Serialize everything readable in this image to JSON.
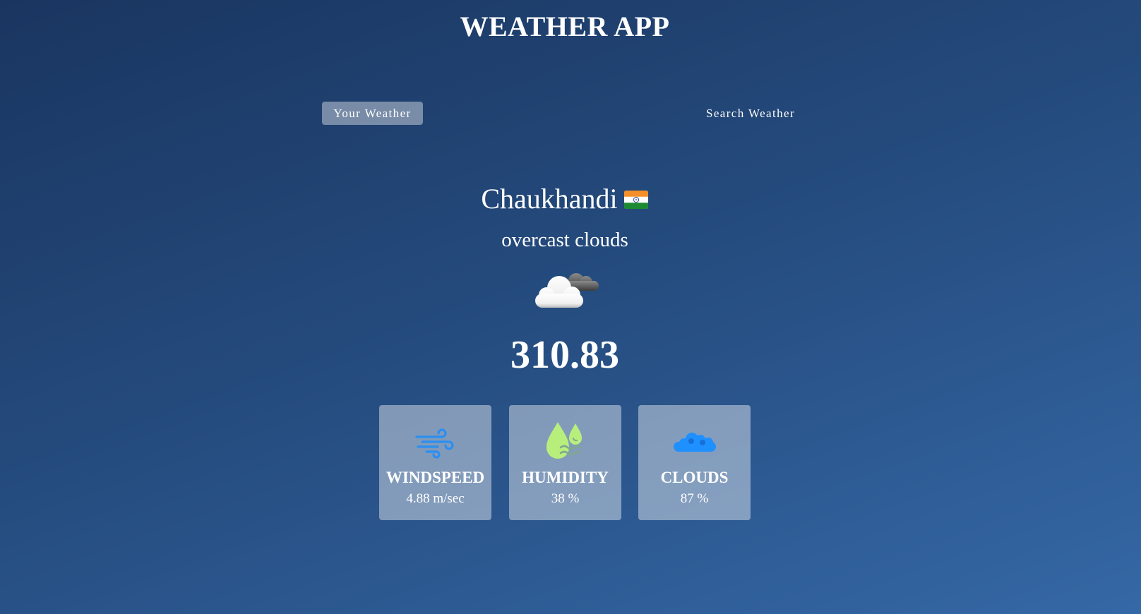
{
  "app": {
    "title": "WEATHER APP"
  },
  "tabs": [
    {
      "label": "Your Weather",
      "active": true
    },
    {
      "label": "Search Weather",
      "active": false
    }
  ],
  "weather": {
    "city": "Chaukhandi",
    "country_flag_icon": "india-flag-icon",
    "description": "overcast clouds",
    "condition_icon": "overcast-clouds-icon",
    "temperature": "310.83"
  },
  "stats": [
    {
      "icon": "wind-icon",
      "label": "WINDSPEED",
      "value": "4.88 m/sec"
    },
    {
      "icon": "humidity-icon",
      "label": "HUMIDITY",
      "value": "38 %"
    },
    {
      "icon": "cloud-icon",
      "label": "CLOUDS",
      "value": "87 %"
    }
  ],
  "colors": {
    "background_top": "#1a3560",
    "background_bottom": "#3568a6",
    "wind_icon": "#2b8ff0",
    "humidity_icon": "#b8ef7c",
    "cloud_icon": "#1e90ff"
  }
}
